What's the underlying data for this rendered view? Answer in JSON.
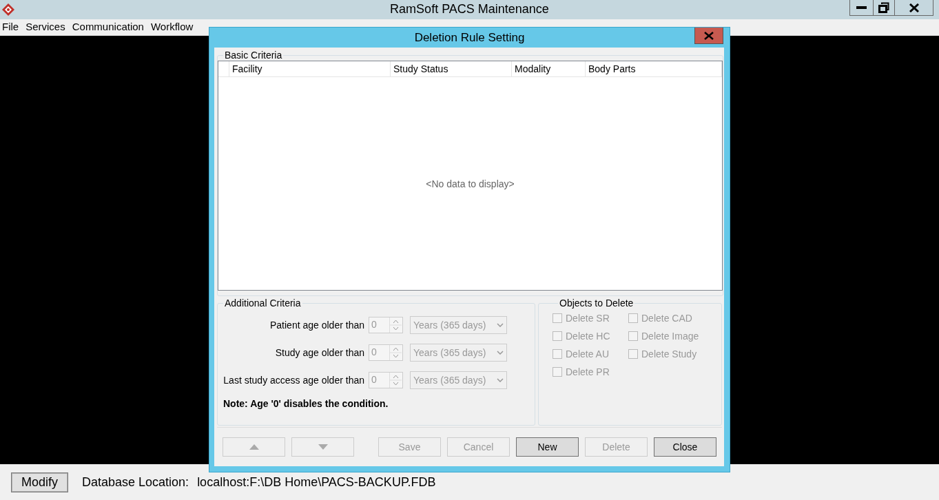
{
  "main_window": {
    "title": "RamSoft PACS Maintenance"
  },
  "menu": [
    "File",
    "Services",
    "Communication",
    "Workflow"
  ],
  "dialog": {
    "title": "Deletion Rule Setting",
    "basic_criteria": {
      "legend": "Basic Criteria",
      "columns": [
        "Facility",
        "Study Status",
        "Modality",
        "Body Parts"
      ],
      "empty_text": "<No data to display>"
    },
    "additional_criteria": {
      "legend": "Additional Criteria",
      "rows": [
        {
          "label": "Patient age older than",
          "value": "0",
          "unit": "Years (365 days)",
          "disabled": true
        },
        {
          "label": "Study age older than",
          "value": "0",
          "unit": "Years (365 days)",
          "disabled": true
        },
        {
          "label": "Last study access age older than",
          "value": "0",
          "unit": "Years (365 days)",
          "disabled": true
        }
      ],
      "note": "Note: Age '0' disables the condition."
    },
    "objects_to_delete": {
      "legend": "Objects to Delete",
      "options": [
        {
          "label": "Delete SR",
          "checked": false,
          "disabled": true
        },
        {
          "label": "Delete CAD",
          "checked": false,
          "disabled": true
        },
        {
          "label": "Delete HC",
          "checked": false,
          "disabled": true
        },
        {
          "label": "Delete Image",
          "checked": false,
          "disabled": true
        },
        {
          "label": "Delete AU",
          "checked": false,
          "disabled": true
        },
        {
          "label": "Delete Study",
          "checked": false,
          "disabled": true
        },
        {
          "label": "Delete PR",
          "checked": false,
          "disabled": true
        }
      ]
    },
    "buttons": [
      {
        "kind": "up",
        "disabled": true
      },
      {
        "kind": "down",
        "disabled": true
      },
      {
        "kind": "text",
        "label": "Save",
        "disabled": true
      },
      {
        "kind": "text",
        "label": "Cancel",
        "disabled": true
      },
      {
        "kind": "text",
        "label": "New",
        "disabled": false
      },
      {
        "kind": "text",
        "label": "Delete",
        "disabled": true
      },
      {
        "kind": "text",
        "label": "Close",
        "disabled": false
      }
    ]
  },
  "status_bar": {
    "button": "Modify",
    "label": "Database Location:",
    "value": "localhost:F:\\DB Home\\PACS-BACKUP.FDB"
  }
}
